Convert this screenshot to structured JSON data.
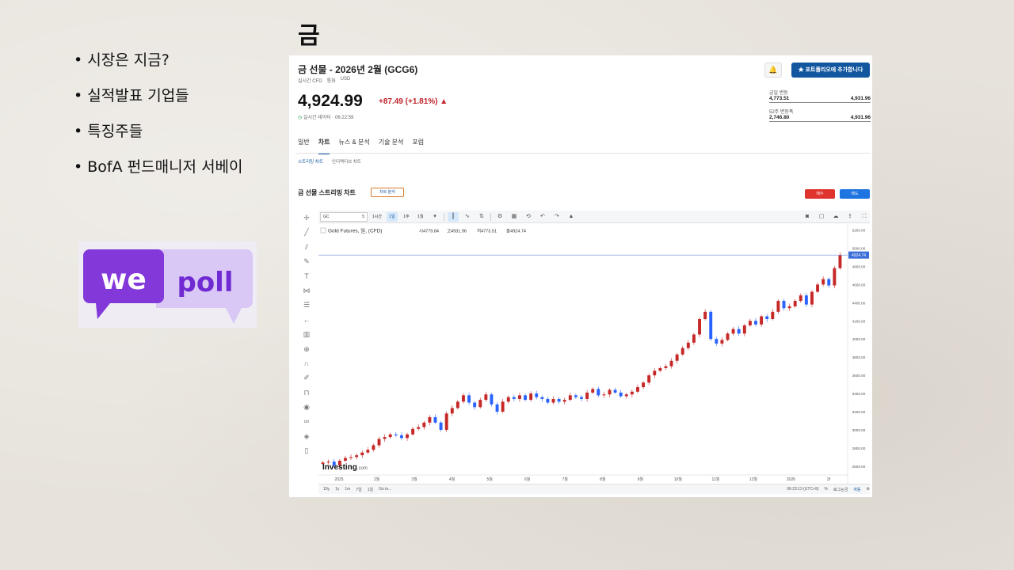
{
  "slide": {
    "title": "금",
    "bullets": [
      "시장은 지금?",
      "실적발표 기업들",
      "특징주들",
      "BofA 펀드매니저 서베이"
    ],
    "logo": {
      "text_left": "we",
      "text_right": "poll",
      "colors": {
        "left_bubble": "#8338d9",
        "right_bubble": "#d9c8f5",
        "right_text": "#6f2ad1"
      }
    }
  },
  "screenshot": {
    "header": {
      "title": "금 선물 - 2026년 2월 (GCG6)",
      "sub1": "실시간 CFD",
      "sub2": "통화",
      "sub3": "USD",
      "alert_icon": "bell-plus-icon",
      "portfolio_button": "★ 포트폴리오에 추가합니다"
    },
    "quote": {
      "price": "4,924.99",
      "change": "+87.49 (+1.81%) ▲",
      "realtime": "실시간 데이터 · 06:22:59",
      "day_range": {
        "label": "금일 변동",
        "low": "4,773.51",
        "high": "4,931.96"
      },
      "week52": {
        "label": "52주 변동폭",
        "low": "2,746.80",
        "high": "4,931.96"
      }
    },
    "tabs": [
      {
        "label": "일반",
        "active": false
      },
      {
        "label": "차트",
        "active": true
      },
      {
        "label": "뉴스 & 분석",
        "active": false
      },
      {
        "label": "기술 분석",
        "active": false
      },
      {
        "label": "포럼",
        "active": false
      }
    ],
    "subtabs": [
      {
        "label": "스트리밍 차트",
        "active": true
      },
      {
        "label": "인터랙티브 차트",
        "active": false
      }
    ],
    "section": {
      "title": "금 선물 스트리밍 차트",
      "chart_analysis": "차트 분석",
      "buy": "매수",
      "sell": "매도"
    },
    "toolbar": {
      "symbol": "GC",
      "symbol_num": "5",
      "intervals": [
        {
          "label": "1시간",
          "active": false
        },
        {
          "label": "1일",
          "active": true
        },
        {
          "label": "1주",
          "active": false
        },
        {
          "label": "1월",
          "active": false
        }
      ]
    },
    "legend": {
      "name": "Gold Futures, 일, (CFD)",
      "open": "시4779.84",
      "high": "고4931.96",
      "low": "저4773.51",
      "close": "종4924.74"
    },
    "bottombar": {
      "ranges": [
        "10y",
        "1y",
        "1m",
        "7일",
        "1일",
        "Go to..."
      ],
      "time": "06:23:13 (UTC+9)",
      "pct": "%",
      "log": "로그눈금",
      "auto": "자동"
    },
    "brand": {
      "main": "Investing",
      "suffix": ".com"
    }
  },
  "chart_data": {
    "type": "candlestick",
    "x_ticks": [
      "2025",
      "2월",
      "3월",
      "4월",
      "5월",
      "6월",
      "7월",
      "8월",
      "9월",
      "10월",
      "11월",
      "12월",
      "2026",
      "2f"
    ],
    "y_ticks": [
      "5200.00",
      "5000.00",
      "4800.00",
      "4600.00",
      "4400.00",
      "4200.00",
      "4000.00",
      "3800.00",
      "3600.00",
      "3400.00",
      "3200.00",
      "3000.00",
      "2800.00",
      "2600.00"
    ],
    "ylim": [
      2520,
      5240
    ],
    "last_price_label": "4924.74",
    "colors": {
      "up": "#2962ff",
      "down": "#c62828"
    },
    "closes": [
      2640,
      2650,
      2610,
      2660,
      2690,
      2700,
      2720,
      2750,
      2780,
      2830,
      2900,
      2920,
      2950,
      2940,
      2910,
      2950,
      3010,
      3030,
      3080,
      3140,
      3080,
      3000,
      3180,
      3240,
      3310,
      3380,
      3300,
      3250,
      3330,
      3390,
      3280,
      3200,
      3310,
      3360,
      3340,
      3380,
      3330,
      3400,
      3360,
      3340,
      3300,
      3340,
      3310,
      3330,
      3380,
      3360,
      3340,
      3410,
      3450,
      3380,
      3390,
      3440,
      3410,
      3370,
      3390,
      3420,
      3470,
      3520,
      3600,
      3650,
      3680,
      3700,
      3760,
      3830,
      3900,
      3960,
      4050,
      4220,
      4300,
      4000,
      3950,
      3990,
      4060,
      4110,
      4060,
      4150,
      4200,
      4160,
      4250,
      4220,
      4300,
      4420,
      4340,
      4360,
      4420,
      4480,
      4380,
      4520,
      4600,
      4660,
      4590,
      4780,
      4924
    ]
  }
}
